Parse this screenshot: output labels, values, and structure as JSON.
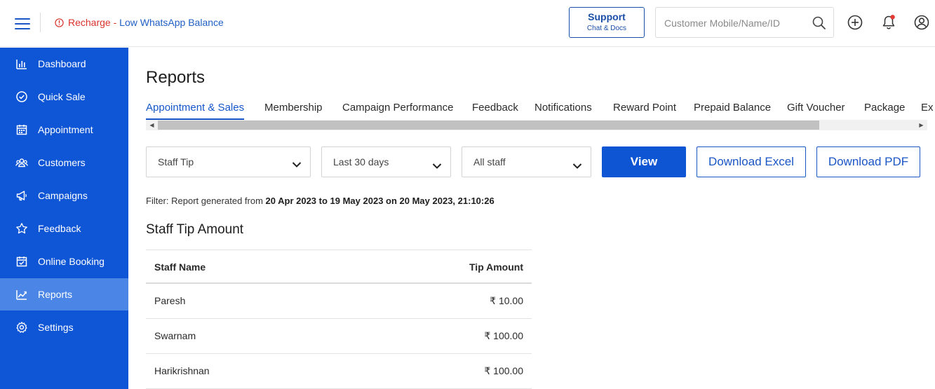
{
  "alert": {
    "recharge": "Recharge",
    "separator": " - ",
    "message": "Low WhatsApp Balance"
  },
  "support": {
    "title": "Support",
    "subtitle": "Chat & Docs"
  },
  "search": {
    "placeholder": "Customer Mobile/Name/ID",
    "value": ""
  },
  "header_icons": [
    "plus-circle-icon",
    "bell-icon",
    "user-icon"
  ],
  "sidebar": {
    "items": [
      {
        "label": "Dashboard",
        "icon": "bar-chart-icon"
      },
      {
        "label": "Quick Sale",
        "icon": "check-circle-icon"
      },
      {
        "label": "Appointment",
        "icon": "calendar-icon"
      },
      {
        "label": "Customers",
        "icon": "users-icon"
      },
      {
        "label": "Campaigns",
        "icon": "megaphone-icon"
      },
      {
        "label": "Feedback",
        "icon": "star-icon"
      },
      {
        "label": "Online Booking",
        "icon": "calendar-check-icon"
      },
      {
        "label": "Reports",
        "icon": "line-chart-icon",
        "active": true
      },
      {
        "label": "Settings",
        "icon": "gear-icon"
      }
    ]
  },
  "page": {
    "title": "Reports"
  },
  "tabs": [
    "Appointment & Sales",
    "Membership",
    "Campaign Performance",
    "Feedback",
    "Notifications",
    "Reward Point",
    "Prepaid Balance",
    "Gift Voucher",
    "Package",
    "Ex"
  ],
  "active_tab": "Appointment & Sales",
  "filters": {
    "report_type": "Staff Tip",
    "date_range": "Last 30 days",
    "staff": "All staff"
  },
  "buttons": {
    "view": "View",
    "download_excel": "Download Excel",
    "download_pdf": "Download PDF"
  },
  "filter_info": {
    "prefix": "Filter: Report generated from ",
    "range": "20 Apr 2023 to 19 May 2023 on 20 May 2023, 21:10:26"
  },
  "section_title": "Staff Tip Amount",
  "table": {
    "headers": [
      "Staff Name",
      "Tip Amount"
    ],
    "rows": [
      [
        "Paresh",
        "₹ 10.00"
      ],
      [
        "Swarnam",
        "₹ 100.00"
      ],
      [
        "Harikrishnan",
        "₹ 100.00"
      ]
    ]
  },
  "colors": {
    "sidebar_bg": "#0f56d6",
    "sidebar_active": "#4b86e6",
    "primary": "#0e55d4",
    "alert_red": "#d9342b",
    "notification_dot": "#e53935"
  }
}
